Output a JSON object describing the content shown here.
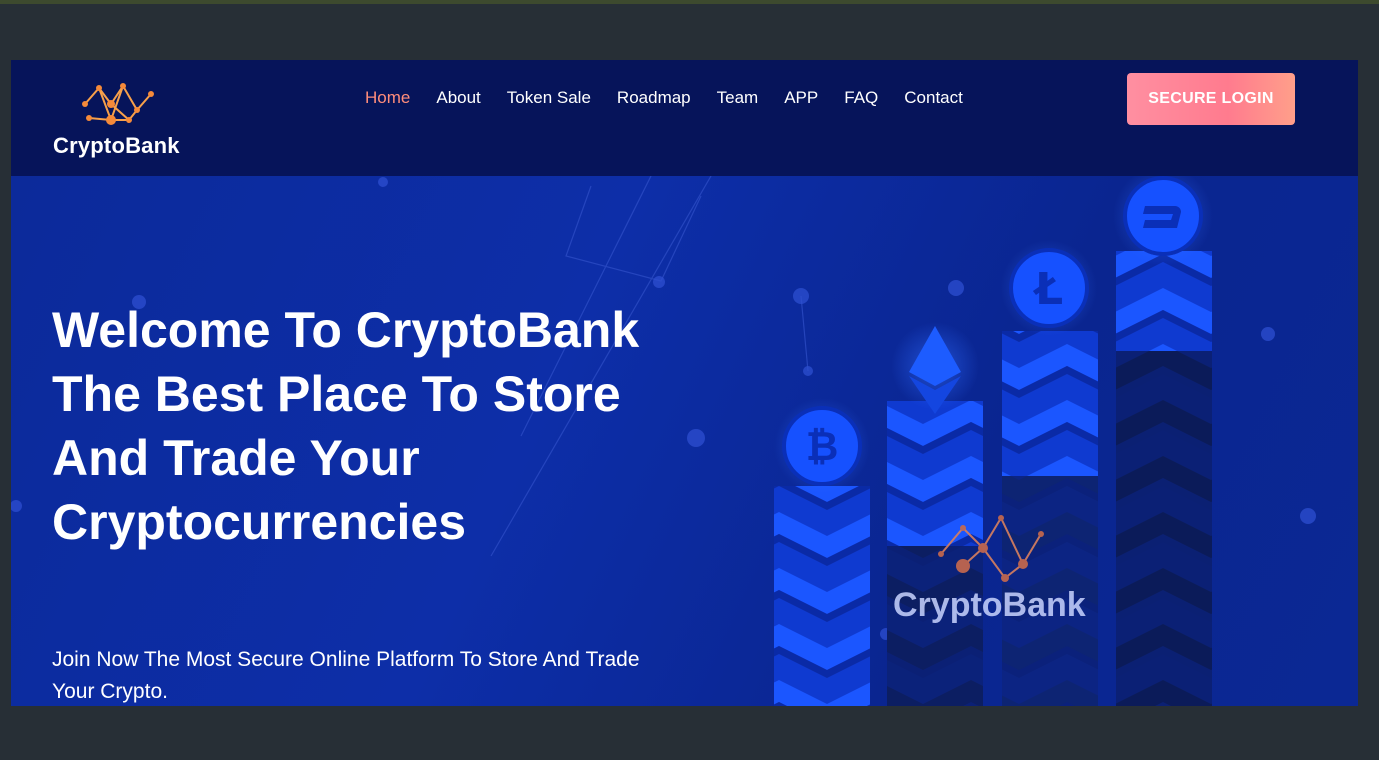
{
  "brand": {
    "name": "CryptoBank"
  },
  "nav": {
    "items": [
      {
        "label": "Home",
        "active": true
      },
      {
        "label": "About",
        "active": false
      },
      {
        "label": "Token Sale",
        "active": false
      },
      {
        "label": "Roadmap",
        "active": false
      },
      {
        "label": "Team",
        "active": false
      },
      {
        "label": "APP",
        "active": false
      },
      {
        "label": "FAQ",
        "active": false
      },
      {
        "label": "Contact",
        "active": false
      }
    ],
    "login_label": "SECURE LOGIN"
  },
  "hero": {
    "headline": "Welcome To CryptoBank The Best Place To Store And Trade Your Cryptocurrencies",
    "subtext": "Join Now The Most Secure Online Platform To Store And Trade Your Crypto.",
    "illustration_brand": "CryptoBank",
    "coins": [
      "bitcoin-icon",
      "ethereum-icon",
      "litecoin-icon",
      "dash-icon"
    ]
  },
  "colors": {
    "nav_bg": "#06145a",
    "hero_bg": "#0d2ea8",
    "active_nav": "#ff8d7b",
    "login_btn": "#ff7b8e",
    "page_bg": "#272f36"
  }
}
